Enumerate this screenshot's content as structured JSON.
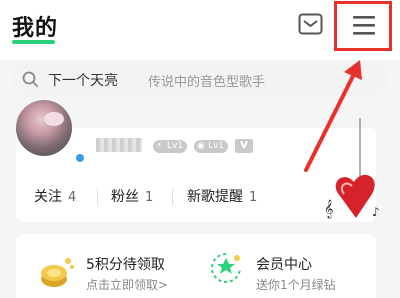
{
  "header": {
    "title": "我的",
    "icons": {
      "mail": "mail-icon",
      "menu": "menu-icon"
    },
    "accent_color": "#2bd07a",
    "highlight_color": "#e8312c"
  },
  "search": {
    "main_text": "下一个天亮",
    "sub_text": "传说中的音色型歌手",
    "icon": "search-icon"
  },
  "profile": {
    "badges": [
      {
        "icon": "lightning-icon",
        "text": "Lv1"
      },
      {
        "icon": "disc-icon",
        "text": "Lv1"
      },
      {
        "icon": "vip-icon",
        "text": "V"
      }
    ],
    "stats": [
      {
        "label": "关注",
        "value": "4"
      },
      {
        "label": "粉丝",
        "value": "1"
      },
      {
        "label": "新歌提醒",
        "value": "1"
      }
    ]
  },
  "features": [
    {
      "title": "5积分待领取",
      "subtitle": "点击立即领取>",
      "icon": "coin-icon"
    },
    {
      "title": "会员中心",
      "subtitle": "送你1个月绿钻",
      "icon": "member-icon"
    }
  ]
}
